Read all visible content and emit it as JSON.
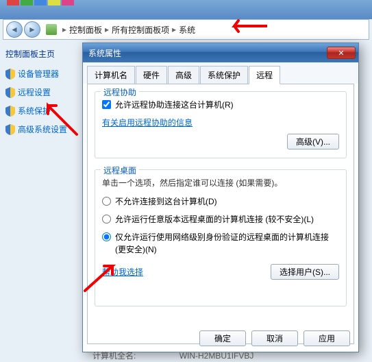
{
  "breadcrumb": {
    "items": [
      "控制面板",
      "所有控制面板项",
      "系统"
    ]
  },
  "sidebar": {
    "title": "控制面板主页",
    "items": [
      {
        "label": "设备管理器"
      },
      {
        "label": "远程设置"
      },
      {
        "label": "系统保护"
      },
      {
        "label": "高级系统设置"
      }
    ]
  },
  "dialog": {
    "title": "系统属性",
    "close_glyph": "✕",
    "tabs": [
      "计算机名",
      "硬件",
      "高级",
      "系统保护",
      "远程"
    ],
    "active_tab": 4,
    "remote_assist": {
      "group_title": "远程协助",
      "checkbox_label": "允许远程协助连接这台计算机(R)",
      "checked": true,
      "link": "有关启用远程协助的信息",
      "advanced_btn": "高级(V)..."
    },
    "remote_desktop": {
      "group_title": "远程桌面",
      "hint": "单击一个选项，然后指定谁可以连接 (如果需要)。",
      "options": [
        {
          "label": "不允许连接到这台计算机(D)",
          "checked": false
        },
        {
          "label": "允许运行任意版本远程桌面的计算机连接 (较不安全)(L)",
          "checked": false
        },
        {
          "label": "仅允许运行使用网络级别身份验证的远程桌面的计算机连接 (更安全)(N)",
          "checked": true
        }
      ],
      "help_link": "帮助我选择",
      "select_users_btn": "选择用户(S)..."
    },
    "buttons": {
      "ok": "确定",
      "cancel": "取消",
      "apply": "应用"
    }
  },
  "background": {
    "label": "计算机全名:",
    "value": "WIN-H2MBU1IFVBJ"
  }
}
